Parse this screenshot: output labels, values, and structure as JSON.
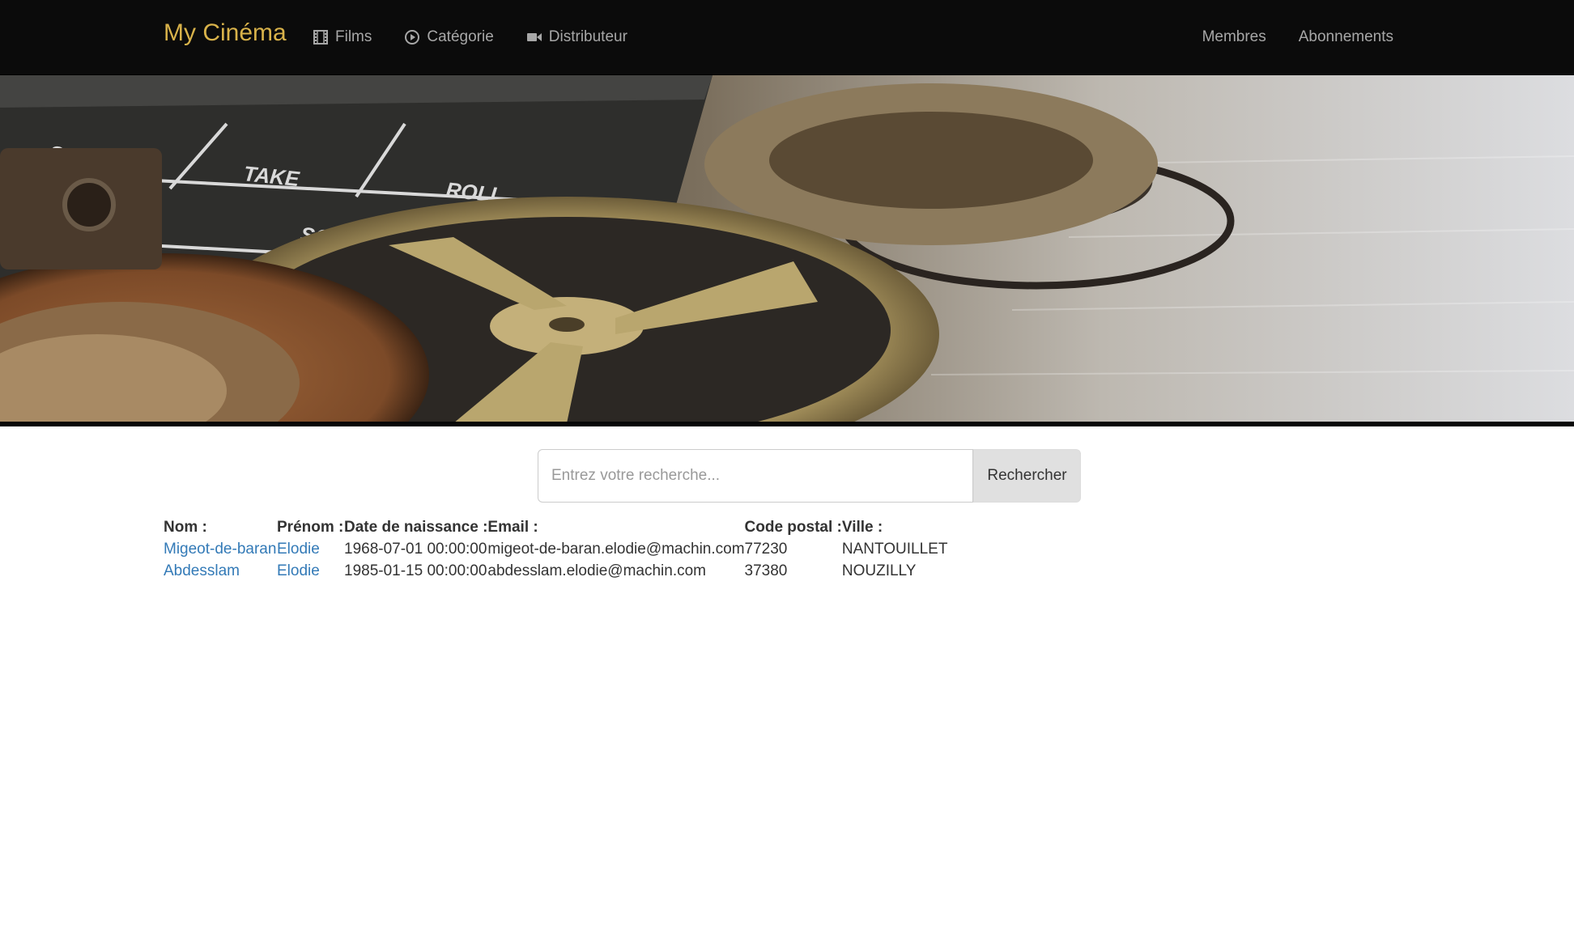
{
  "navbar": {
    "brand": "My Cinéma",
    "left_items": [
      {
        "label": "Films",
        "icon": "film-icon"
      },
      {
        "label": "Catégorie",
        "icon": "play-circle-icon"
      },
      {
        "label": "Distributeur",
        "icon": "video-camera-icon"
      }
    ],
    "right_items": [
      {
        "label": "Membres"
      },
      {
        "label": "Abonnements"
      }
    ]
  },
  "banner": {
    "clapper_labels": [
      "SCENE",
      "TAKE",
      "ROLL",
      "SOUND"
    ]
  },
  "search": {
    "placeholder": "Entrez votre recherche...",
    "value": "",
    "button_label": "Rechercher"
  },
  "table": {
    "headers": [
      "Nom :",
      "Prénom :",
      "Date de naissance :",
      "Email :",
      "Code postal :",
      "Ville :"
    ],
    "rows": [
      {
        "nom": "Migeot-de-baran",
        "prenom": "Elodie",
        "date": "1968-07-01 00:00:00",
        "email": "migeot-de-baran.elodie@machin.com",
        "cp": "77230",
        "ville": "NANTOUILLET"
      },
      {
        "nom": "Abdesslam",
        "prenom": "Elodie",
        "date": "1985-01-15 00:00:00",
        "email": "abdesslam.elodie@machin.com",
        "cp": "37380",
        "ville": "NOUZILLY"
      }
    ]
  },
  "colors": {
    "navbar_bg": "#0b0b0b",
    "brand": "#d8b24a",
    "nav_text": "#a7a7a7",
    "link": "#337ab7"
  }
}
